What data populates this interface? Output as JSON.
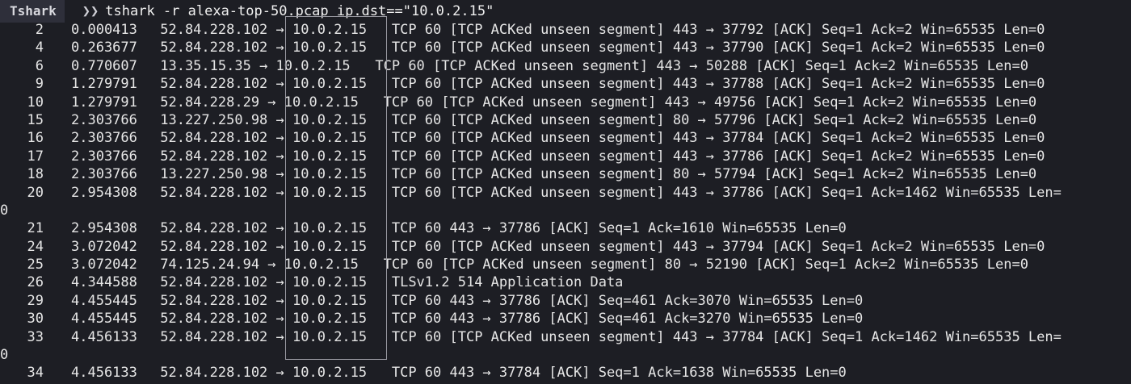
{
  "prompt": {
    "label": "Tshark",
    "arrow": "❯❯",
    "command": "tshark -r alexa-top-50.pcap ip.dst==\"10.0.2.15\""
  },
  "packets": [
    {
      "no": "2",
      "time": "0.000413",
      "src": "52.84.228.102",
      "arrow": "→",
      "dst": "10.0.2.15",
      "info": "TCP 60 [TCP ACKed unseen segment] 443 → 37792 [ACK] Seq=1 Ack=2 Win=65535 Len=0"
    },
    {
      "no": "4",
      "time": "0.263677",
      "src": "52.84.228.102",
      "arrow": "→",
      "dst": "10.0.2.15",
      "info": "TCP 60 [TCP ACKed unseen segment] 443 → 37790 [ACK] Seq=1 Ack=2 Win=65535 Len=0"
    },
    {
      "no": "6",
      "time": "0.770607",
      "src": "13.35.15.35",
      "arrow": "→",
      "dst": "10.0.2.15",
      "info": "TCP 60 [TCP ACKed unseen segment] 443 → 50288 [ACK] Seq=1 Ack=2 Win=65535 Len=0"
    },
    {
      "no": "9",
      "time": "1.279791",
      "src": "52.84.228.102",
      "arrow": "→",
      "dst": "10.0.2.15",
      "info": "TCP 60 [TCP ACKed unseen segment] 443 → 37788 [ACK] Seq=1 Ack=2 Win=65535 Len=0"
    },
    {
      "no": "10",
      "time": "1.279791",
      "src": "52.84.228.29",
      "arrow": "→",
      "dst": "10.0.2.15",
      "info": "TCP 60 [TCP ACKed unseen segment] 443 → 49756 [ACK] Seq=1 Ack=2 Win=65535 Len=0"
    },
    {
      "no": "15",
      "time": "2.303766",
      "src": "13.227.250.98",
      "arrow": "→",
      "dst": "10.0.2.15",
      "info": "TCP 60 [TCP ACKed unseen segment] 80 → 57796 [ACK] Seq=1 Ack=2 Win=65535 Len=0"
    },
    {
      "no": "16",
      "time": "2.303766",
      "src": "52.84.228.102",
      "arrow": "→",
      "dst": "10.0.2.15",
      "info": "TCP 60 [TCP ACKed unseen segment] 443 → 37784 [ACK] Seq=1 Ack=2 Win=65535 Len=0"
    },
    {
      "no": "17",
      "time": "2.303766",
      "src": "52.84.228.102",
      "arrow": "→",
      "dst": "10.0.2.15",
      "info": "TCP 60 [TCP ACKed unseen segment] 443 → 37786 [ACK] Seq=1 Ack=2 Win=65535 Len=0"
    },
    {
      "no": "18",
      "time": "2.303766",
      "src": "13.227.250.98",
      "arrow": "→",
      "dst": "10.0.2.15",
      "info": "TCP 60 [TCP ACKed unseen segment] 80 → 57794 [ACK] Seq=1 Ack=2 Win=65535 Len=0"
    },
    {
      "no": "20",
      "time": "2.954308",
      "src": "52.84.228.102",
      "arrow": "→",
      "dst": "10.0.2.15",
      "info": "TCP 60 [TCP ACKed unseen segment] 443 → 37786 [ACK] Seq=1 Ack=1462 Win=65535 Len=",
      "wrap": "0"
    },
    {
      "no": "21",
      "time": "2.954308",
      "src": "52.84.228.102",
      "arrow": "→",
      "dst": "10.0.2.15",
      "info": "TCP 60 443 → 37786 [ACK] Seq=1 Ack=1610 Win=65535 Len=0"
    },
    {
      "no": "24",
      "time": "3.072042",
      "src": "52.84.228.102",
      "arrow": "→",
      "dst": "10.0.2.15",
      "info": "TCP 60 [TCP ACKed unseen segment] 443 → 37794 [ACK] Seq=1 Ack=2 Win=65535 Len=0"
    },
    {
      "no": "25",
      "time": "3.072042",
      "src": "74.125.24.94",
      "arrow": "→",
      "dst": "10.0.2.15",
      "info": "TCP 60 [TCP ACKed unseen segment] 80 → 52190 [ACK] Seq=1 Ack=2 Win=65535 Len=0"
    },
    {
      "no": "26",
      "time": "4.344588",
      "src": "52.84.228.102",
      "arrow": "→",
      "dst": "10.0.2.15",
      "info": "TLSv1.2 514 Application Data"
    },
    {
      "no": "29",
      "time": "4.455445",
      "src": "52.84.228.102",
      "arrow": "→",
      "dst": "10.0.2.15",
      "info": "TCP 60 443 → 37786 [ACK] Seq=461 Ack=3070 Win=65535 Len=0"
    },
    {
      "no": "30",
      "time": "4.455445",
      "src": "52.84.228.102",
      "arrow": "→",
      "dst": "10.0.2.15",
      "info": "TCP 60 443 → 37786 [ACK] Seq=461 Ack=3270 Win=65535 Len=0"
    },
    {
      "no": "33",
      "time": "4.456133",
      "src": "52.84.228.102",
      "arrow": "→",
      "dst": "10.0.2.15",
      "info": "TCP 60 [TCP ACKed unseen segment] 443 → 37784 [ACK] Seq=1 Ack=1462 Win=65535 Len=",
      "wrap": "0"
    },
    {
      "no": "34",
      "time": "4.456133",
      "src": "52.84.228.102",
      "arrow": "→",
      "dst": "10.0.2.15",
      "info": "TCP 60 443 → 37784 [ACK] Seq=1 Ack=1638 Win=65535 Len=0"
    }
  ],
  "colors": {
    "background": "#1d1e24",
    "text": "#e6e6e6",
    "prompt_label_bg": "#2e2f3a",
    "highlight_border": "#9a9aa2"
  }
}
